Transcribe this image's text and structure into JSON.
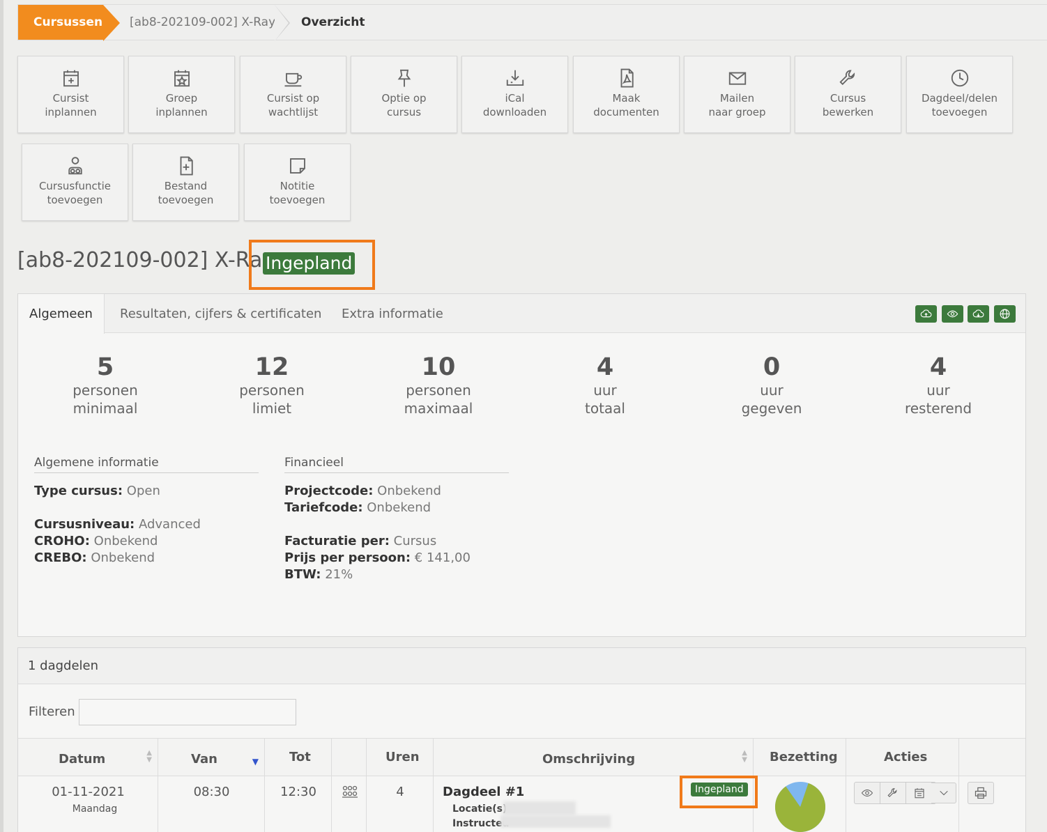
{
  "breadcrumb": {
    "home": "Cursussen",
    "course": "[ab8-202109-002] X-Ray",
    "current": "Overzicht"
  },
  "actions": [
    {
      "icon": "calendar-plus-icon",
      "label": "Cursist\ninplannen"
    },
    {
      "icon": "calendar-star-icon",
      "label": "Groep\ninplannen"
    },
    {
      "icon": "coffee-cup-icon",
      "label": "Cursist op\nwachtlijst"
    },
    {
      "icon": "pin-icon",
      "label": "Optie op\ncursus"
    },
    {
      "icon": "download-tray-icon",
      "label": "iCal\ndownloaden"
    },
    {
      "icon": "pdf-document-icon",
      "label": "Maak\ndocumenten"
    },
    {
      "icon": "envelope-icon",
      "label": "Mailen\nnaar groep"
    },
    {
      "icon": "wrench-icon",
      "label": "Cursus\nbewerken"
    },
    {
      "icon": "clock-icon",
      "label": "Dagdeel/delen\ntoevoegen"
    },
    {
      "icon": "person-group-icon",
      "label": "Cursusfunctie\ntoevoegen"
    },
    {
      "icon": "file-plus-icon",
      "label": "Bestand\ntoevoegen"
    },
    {
      "icon": "note-icon",
      "label": "Notitie\ntoevoegen"
    }
  ],
  "title": "[ab8-202109-002] X-Ray",
  "status": "Ingepland",
  "colors": {
    "accent": "#f28c1e",
    "status_green": "#3c7a3c",
    "highlight": "#f07a1a"
  },
  "tabs": [
    "Algemeen",
    "Resultaten, cijfers & certificaten",
    "Extra informatie"
  ],
  "tab_buttons": [
    "cloud-upload-icon",
    "eye-icon",
    "cloud-download-icon",
    "globe-icon"
  ],
  "stats": [
    {
      "value": "5",
      "label": "personen\nminimaal"
    },
    {
      "value": "12",
      "label": "personen\nlimiet"
    },
    {
      "value": "10",
      "label": "personen\nmaximaal"
    },
    {
      "value": "4",
      "label": "uur\ntotaal"
    },
    {
      "value": "0",
      "label": "uur\ngegeven"
    },
    {
      "value": "4",
      "label": "uur\nresterend"
    }
  ],
  "general": {
    "heading": "Algemene informatie",
    "type_label": "Type cursus:",
    "type_value": "Open",
    "level_label": "Cursusniveau:",
    "level_value": "Advanced",
    "croho_label": "CROHO:",
    "croho_value": "Onbekend",
    "crebo_label": "CREBO:",
    "crebo_value": "Onbekend"
  },
  "financial": {
    "heading": "Financieel",
    "project_label": "Projectcode:",
    "project_value": "Onbekend",
    "tariff_label": "Tariefcode:",
    "tariff_value": "Onbekend",
    "invoice_label": "Facturatie per:",
    "invoice_value": "Cursus",
    "price_label": "Prijs per persoon:",
    "price_value": "€ 141,00",
    "vat_label": "BTW:",
    "vat_value": "21%"
  },
  "sessions": {
    "heading": "1 dagdelen",
    "filter_label": "Filteren",
    "filter_value": "",
    "columns": [
      "Datum",
      "Van",
      "Tot",
      "",
      "Uren",
      "Omschrijving",
      "Bezetting",
      "Acties",
      ""
    ],
    "rows": [
      {
        "date": "01-11-2021",
        "weekday": "Maandag",
        "from": "08:30",
        "to": "12:30",
        "hours": "4",
        "title": "Dagdeel #1",
        "location_label": "Locatie(s):",
        "instructor_label": "Instructeu",
        "status": "Ingepland",
        "occupancy": 0.85
      }
    ]
  }
}
